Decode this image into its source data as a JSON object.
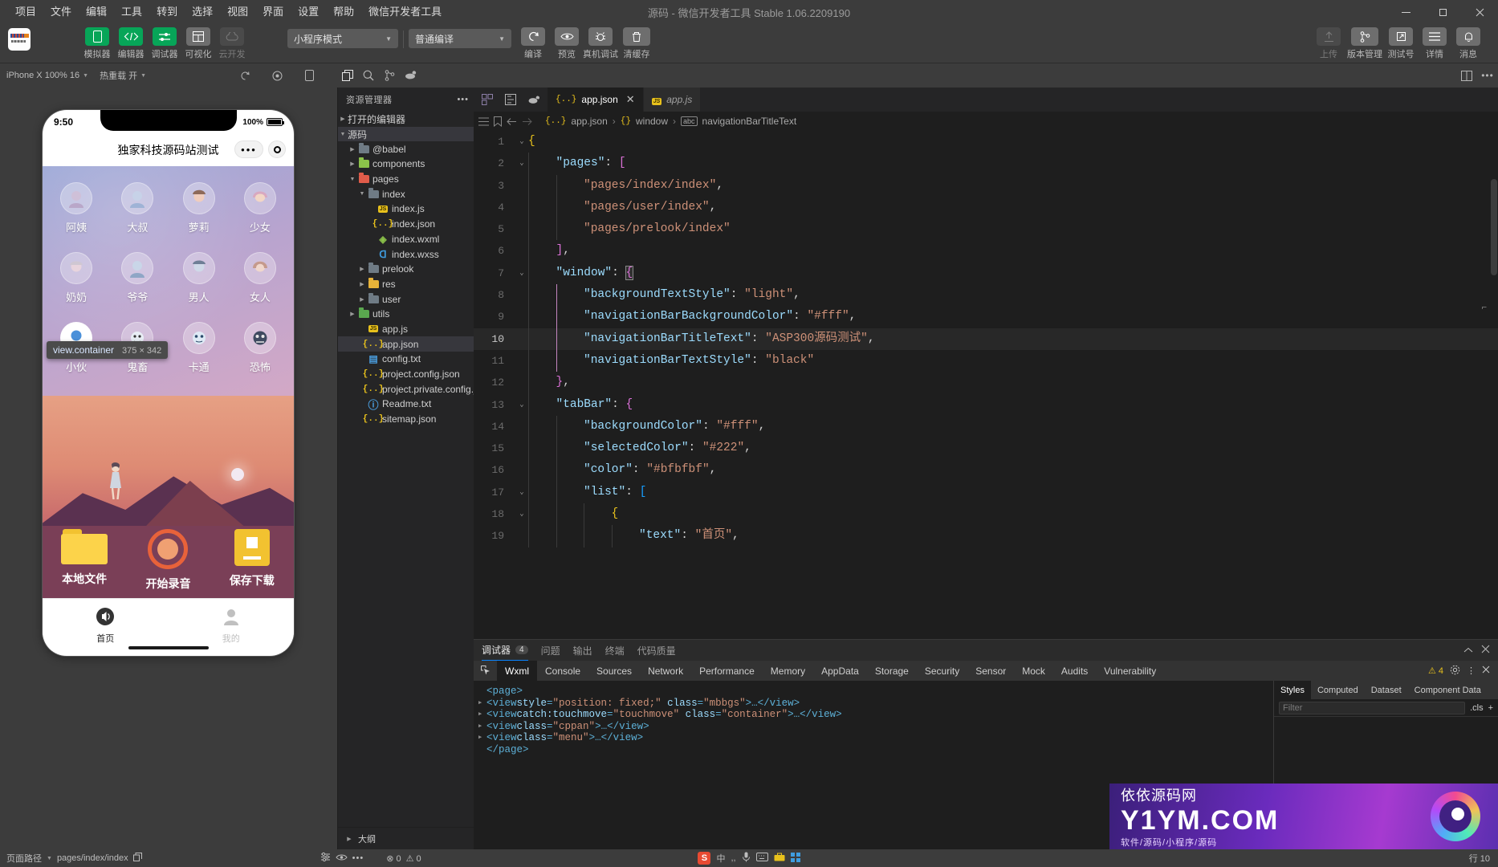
{
  "window": {
    "title": "源码 - 微信开发者工具 Stable 1.06.2209190",
    "controls": {
      "minimize": "minimize-icon",
      "maximize": "maximize-icon",
      "close": "close-icon"
    }
  },
  "menubar": {
    "items": [
      {
        "label": "项目"
      },
      {
        "label": "文件"
      },
      {
        "label": "编辑"
      },
      {
        "label": "工具"
      },
      {
        "label": "转到"
      },
      {
        "label": "选择"
      },
      {
        "label": "视图"
      },
      {
        "label": "界面"
      },
      {
        "label": "设置"
      },
      {
        "label": "帮助"
      },
      {
        "label": "微信开发者工具"
      }
    ]
  },
  "toolbar": {
    "left_buttons": [
      {
        "label": "模拟器",
        "icon": "phone-icon",
        "active": true
      },
      {
        "label": "编辑器",
        "icon": "code-icon",
        "active": true
      },
      {
        "label": "调试器",
        "icon": "sliders-icon",
        "active": true
      },
      {
        "label": "可视化",
        "icon": "layout-icon",
        "active": false
      },
      {
        "label": "云开发",
        "icon": "cloud-icon",
        "active": false
      }
    ],
    "mode_select": {
      "value": "小程序模式",
      "caret": "chevron-down-icon"
    },
    "compile_select": {
      "value": "普通编译",
      "caret": "chevron-down-icon"
    },
    "mid_buttons": [
      {
        "label": "编译",
        "icon": "refresh-icon"
      },
      {
        "label": "预览",
        "icon": "eye-icon"
      },
      {
        "label": "真机调试",
        "icon": "bug-icon"
      },
      {
        "label": "清缓存",
        "icon": "trash-icon"
      }
    ],
    "right_buttons": [
      {
        "label": "上传",
        "icon": "upload-icon",
        "disabled": true
      },
      {
        "label": "版本管理",
        "icon": "branch-icon",
        "disabled": false
      },
      {
        "label": "测试号",
        "icon": "external-link-icon",
        "disabled": false
      },
      {
        "label": "详情",
        "icon": "menu-lines-icon",
        "disabled": false
      },
      {
        "label": "消息",
        "icon": "bell-icon",
        "disabled": false
      }
    ]
  },
  "subbar": {
    "device": "iPhone X 100% 16",
    "hotreload": "热重载 开",
    "icons": [
      "rotate-icon",
      "record-icon",
      "device-icon",
      "copy-files-icon",
      "search-icon",
      "branch-icon",
      "docker-icon",
      "plug-icon"
    ],
    "right_icons": [
      "split-editor-icon",
      "more-icon"
    ]
  },
  "simulator": {
    "status_time": "9:50",
    "battery_text": "100%",
    "page_title": "独家科技源码站测试",
    "capsule": {
      "menu": "•••",
      "target": "target-icon"
    },
    "grid": [
      {
        "label": "阿姨",
        "icon": "avatar-aunt"
      },
      {
        "label": "大叔",
        "icon": "avatar-uncle"
      },
      {
        "label": "萝莉",
        "icon": "avatar-loli"
      },
      {
        "label": "少女",
        "icon": "avatar-girl"
      },
      {
        "label": "奶奶",
        "icon": "avatar-grandma"
      },
      {
        "label": "爷爷",
        "icon": "avatar-grandpa"
      },
      {
        "label": "男人",
        "icon": "avatar-man"
      },
      {
        "label": "女人",
        "icon": "avatar-woman"
      },
      {
        "label": "小伙",
        "icon": "avatar-youth",
        "selected": true
      },
      {
        "label": "鬼畜",
        "icon": "avatar-kichiku"
      },
      {
        "label": "卡通",
        "icon": "avatar-cartoon"
      },
      {
        "label": "恐怖",
        "icon": "avatar-horror"
      }
    ],
    "inspect_tooltip": {
      "selector": "view.container",
      "size": "375 × 342"
    },
    "actions": [
      {
        "label": "本地文件",
        "icon": "folder-icon"
      },
      {
        "label": "开始录音",
        "icon": "record-circle-icon"
      },
      {
        "label": "保存下载",
        "icon": "save-icon"
      }
    ],
    "tabbar": [
      {
        "label": "首页",
        "icon": "speaker-icon",
        "active": true
      },
      {
        "label": "我的",
        "icon": "person-icon",
        "active": false
      }
    ]
  },
  "explorer": {
    "header": "资源管理器",
    "more": "more-icon",
    "sections": [
      {
        "label": "打开的编辑器",
        "expanded": false,
        "indent": 0
      },
      {
        "label": "源码",
        "expanded": true,
        "indent": 0
      }
    ],
    "tree": [
      {
        "label": "@babel",
        "type": "folder",
        "icon": "folder-gray",
        "indent": 1,
        "expanded": false
      },
      {
        "label": "components",
        "type": "folder",
        "icon": "folder-green",
        "indent": 1,
        "expanded": false
      },
      {
        "label": "pages",
        "type": "folder",
        "icon": "folder-red",
        "indent": 1,
        "expanded": true
      },
      {
        "label": "index",
        "type": "folder",
        "icon": "folder-gray",
        "indent": 2,
        "expanded": true
      },
      {
        "label": "index.js",
        "type": "file",
        "icon": "js-icon",
        "indent": 3
      },
      {
        "label": "index.json",
        "type": "file",
        "icon": "json-icon",
        "indent": 3
      },
      {
        "label": "index.wxml",
        "type": "file",
        "icon": "wxml-icon",
        "indent": 3
      },
      {
        "label": "index.wxss",
        "type": "file",
        "icon": "wxss-icon",
        "indent": 3
      },
      {
        "label": "prelook",
        "type": "folder",
        "icon": "folder-gray",
        "indent": 2,
        "expanded": false
      },
      {
        "label": "res",
        "type": "folder",
        "icon": "folder-yellow",
        "indent": 2,
        "expanded": false
      },
      {
        "label": "user",
        "type": "folder",
        "icon": "folder-gray",
        "indent": 2,
        "expanded": false
      },
      {
        "label": "utils",
        "type": "folder",
        "icon": "folder-green",
        "indent": 1,
        "expanded": false
      },
      {
        "label": "app.js",
        "type": "file",
        "icon": "js-icon",
        "indent": 1
      },
      {
        "label": "app.json",
        "type": "file",
        "icon": "json-icon",
        "indent": 1,
        "active": true
      },
      {
        "label": "config.txt",
        "type": "file",
        "icon": "txt-icon",
        "indent": 1
      },
      {
        "label": "project.config.json",
        "type": "file",
        "icon": "json-icon",
        "indent": 1
      },
      {
        "label": "project.private.config.js...",
        "type": "file",
        "icon": "json-icon",
        "indent": 1
      },
      {
        "label": "Readme.txt",
        "type": "file",
        "icon": "info-icon",
        "indent": 1
      },
      {
        "label": "sitemap.json",
        "type": "file",
        "icon": "json-icon",
        "indent": 1
      }
    ],
    "footer": {
      "label": "大纲",
      "expanded": false
    }
  },
  "editor": {
    "strip_icons": [
      "components-icon",
      "snippet-icon",
      "teapot-icon"
    ],
    "tabs": [
      {
        "label": "app.json",
        "icon": "json-icon",
        "active": true,
        "closable": true
      },
      {
        "label": "app.js",
        "icon": "js-icon",
        "active": false,
        "italic": true
      }
    ],
    "gutter_icons": [
      "list-icon",
      "bookmark-icon",
      "arrow-left-icon",
      "arrow-right-icon"
    ],
    "breadcrumb": [
      {
        "label": "app.json",
        "icon": "json-icon"
      },
      {
        "label": "window",
        "icon": "braces-icon"
      },
      {
        "label": "navigationBarTitleText",
        "icon": "abc-icon"
      }
    ],
    "active_line": 10,
    "lines": [
      {
        "n": 1,
        "fold": "chevron-down",
        "indent": 0,
        "tokens": [
          {
            "t": "{",
            "c": "br"
          }
        ]
      },
      {
        "n": 2,
        "fold": "chevron-down",
        "indent": 1,
        "tokens": [
          {
            "t": "\"pages\"",
            "c": "k"
          },
          {
            "t": ": ",
            "c": "p"
          },
          {
            "t": "[",
            "c": "br2"
          }
        ]
      },
      {
        "n": 3,
        "fold": "",
        "indent": 2,
        "tokens": [
          {
            "t": "\"pages/index/index\"",
            "c": "s"
          },
          {
            "t": ",",
            "c": "p"
          }
        ]
      },
      {
        "n": 4,
        "fold": "",
        "indent": 2,
        "tokens": [
          {
            "t": "\"pages/user/index\"",
            "c": "s"
          },
          {
            "t": ",",
            "c": "p"
          }
        ]
      },
      {
        "n": 5,
        "fold": "",
        "indent": 2,
        "tokens": [
          {
            "t": "\"pages/prelook/index\"",
            "c": "s"
          }
        ]
      },
      {
        "n": 6,
        "fold": "",
        "indent": 1,
        "tokens": [
          {
            "t": "]",
            "c": "br2"
          },
          {
            "t": ",",
            "c": "p"
          }
        ]
      },
      {
        "n": 7,
        "fold": "chevron-down",
        "indent": 1,
        "tokens": [
          {
            "t": "\"window\"",
            "c": "k"
          },
          {
            "t": ": ",
            "c": "p"
          },
          {
            "t": "{",
            "c": "br2 bmatch"
          }
        ]
      },
      {
        "n": 8,
        "fold": "",
        "indent": 2,
        "tokens": [
          {
            "t": "\"backgroundTextStyle\"",
            "c": "k"
          },
          {
            "t": ": ",
            "c": "p"
          },
          {
            "t": "\"light\"",
            "c": "s"
          },
          {
            "t": ",",
            "c": "p"
          }
        ]
      },
      {
        "n": 9,
        "fold": "",
        "indent": 2,
        "tokens": [
          {
            "t": "\"navigationBarBackgroundColor\"",
            "c": "k"
          },
          {
            "t": ": ",
            "c": "p"
          },
          {
            "t": "\"#fff\"",
            "c": "s"
          },
          {
            "t": ",",
            "c": "p"
          }
        ]
      },
      {
        "n": 10,
        "fold": "",
        "indent": 2,
        "tokens": [
          {
            "t": "\"navigationBarTitleText\"",
            "c": "k"
          },
          {
            "t": ": ",
            "c": "p"
          },
          {
            "t": "\"ASP300源码测试\"",
            "c": "s"
          },
          {
            "t": ",",
            "c": "p"
          }
        ]
      },
      {
        "n": 11,
        "fold": "",
        "indent": 2,
        "tokens": [
          {
            "t": "\"navigationBarTextStyle\"",
            "c": "k"
          },
          {
            "t": ": ",
            "c": "p"
          },
          {
            "t": "\"black\"",
            "c": "s"
          }
        ]
      },
      {
        "n": 12,
        "fold": "",
        "indent": 1,
        "tokens": [
          {
            "t": "}",
            "c": "br2"
          },
          {
            "t": ",",
            "c": "p"
          }
        ]
      },
      {
        "n": 13,
        "fold": "chevron-down",
        "indent": 1,
        "tokens": [
          {
            "t": "\"tabBar\"",
            "c": "k"
          },
          {
            "t": ": ",
            "c": "p"
          },
          {
            "t": "{",
            "c": "br2"
          }
        ]
      },
      {
        "n": 14,
        "fold": "",
        "indent": 2,
        "tokens": [
          {
            "t": "\"backgroundColor\"",
            "c": "k"
          },
          {
            "t": ": ",
            "c": "p"
          },
          {
            "t": "\"#fff\"",
            "c": "s"
          },
          {
            "t": ",",
            "c": "p"
          }
        ]
      },
      {
        "n": 15,
        "fold": "",
        "indent": 2,
        "tokens": [
          {
            "t": "\"selectedColor\"",
            "c": "k"
          },
          {
            "t": ": ",
            "c": "p"
          },
          {
            "t": "\"#222\"",
            "c": "s"
          },
          {
            "t": ",",
            "c": "p"
          }
        ]
      },
      {
        "n": 16,
        "fold": "",
        "indent": 2,
        "tokens": [
          {
            "t": "\"color\"",
            "c": "k"
          },
          {
            "t": ": ",
            "c": "p"
          },
          {
            "t": "\"#bfbfbf\"",
            "c": "s"
          },
          {
            "t": ",",
            "c": "p"
          }
        ]
      },
      {
        "n": 17,
        "fold": "chevron-down",
        "indent": 2,
        "tokens": [
          {
            "t": "\"list\"",
            "c": "k"
          },
          {
            "t": ": ",
            "c": "p"
          },
          {
            "t": "[",
            "c": "br3"
          }
        ]
      },
      {
        "n": 18,
        "fold": "chevron-down",
        "indent": 3,
        "tokens": [
          {
            "t": "{",
            "c": "br"
          }
        ]
      },
      {
        "n": 19,
        "fold": "",
        "indent": 4,
        "tokens": [
          {
            "t": "\"text\"",
            "c": "k"
          },
          {
            "t": ": ",
            "c": "p"
          },
          {
            "t": "\"首页\"",
            "c": "s"
          },
          {
            "t": ",",
            "c": "p"
          }
        ]
      }
    ]
  },
  "devtools": {
    "top_tabs": [
      {
        "label": "调试器",
        "count": "4",
        "active": true
      },
      {
        "label": "问题",
        "active": false
      },
      {
        "label": "输出",
        "active": false
      },
      {
        "label": "终端",
        "active": false
      },
      {
        "label": "代码质量",
        "active": false
      }
    ],
    "top_right_icons": [
      "chevron-up-icon",
      "close-icon"
    ],
    "panel_tabs": [
      {
        "label": "Wxml",
        "active": true
      },
      {
        "label": "Console",
        "active": false
      },
      {
        "label": "Sources",
        "active": false
      },
      {
        "label": "Network",
        "active": false
      },
      {
        "label": "Performance",
        "active": false
      },
      {
        "label": "Memory",
        "active": false
      },
      {
        "label": "AppData",
        "active": false
      },
      {
        "label": "Storage",
        "active": false
      },
      {
        "label": "Security",
        "active": false
      },
      {
        "label": "Sensor",
        "active": false
      },
      {
        "label": "Mock",
        "active": false
      },
      {
        "label": "Audits",
        "active": false
      },
      {
        "label": "Vulnerability",
        "active": false
      }
    ],
    "panel_right": {
      "warning_count": "4",
      "icons": [
        "gear-icon",
        "more-vertical-icon",
        "close-icon"
      ]
    },
    "dom": [
      {
        "indent": 0,
        "tri": "",
        "parts": [
          {
            "t": "<page>",
            "c": "tg"
          }
        ]
      },
      {
        "indent": 1,
        "tri": "right",
        "parts": [
          {
            "t": "<view ",
            "c": "tg"
          },
          {
            "t": "style",
            "c": "at"
          },
          {
            "t": "=",
            "c": "tg"
          },
          {
            "t": "\"position: fixed;\"",
            "c": "av"
          },
          {
            "t": " ",
            "c": "tg"
          },
          {
            "t": "class",
            "c": "at"
          },
          {
            "t": "=",
            "c": "tg"
          },
          {
            "t": "\"mbbgs\"",
            "c": "av"
          },
          {
            "t": ">…</view>",
            "c": "tg"
          }
        ]
      },
      {
        "indent": 1,
        "tri": "right",
        "parts": [
          {
            "t": "<view ",
            "c": "tg"
          },
          {
            "t": "catch:touchmove",
            "c": "at"
          },
          {
            "t": "=",
            "c": "tg"
          },
          {
            "t": "\"touchmove\"",
            "c": "av"
          },
          {
            "t": " ",
            "c": "tg"
          },
          {
            "t": "class",
            "c": "at"
          },
          {
            "t": "=",
            "c": "tg"
          },
          {
            "t": "\"container\"",
            "c": "av"
          },
          {
            "t": ">…</view>",
            "c": "tg"
          }
        ]
      },
      {
        "indent": 1,
        "tri": "right",
        "parts": [
          {
            "t": "<view ",
            "c": "tg"
          },
          {
            "t": "class",
            "c": "at"
          },
          {
            "t": "=",
            "c": "tg"
          },
          {
            "t": "\"cppan\"",
            "c": "av"
          },
          {
            "t": ">…</view>",
            "c": "tg"
          }
        ]
      },
      {
        "indent": 1,
        "tri": "right",
        "parts": [
          {
            "t": "<view ",
            "c": "tg"
          },
          {
            "t": "class",
            "c": "at"
          },
          {
            "t": "=",
            "c": "tg"
          },
          {
            "t": "\"menu\"",
            "c": "av"
          },
          {
            "t": ">…</view>",
            "c": "tg"
          }
        ]
      },
      {
        "indent": 0,
        "tri": "",
        "parts": [
          {
            "t": "</page>",
            "c": "tg"
          }
        ]
      }
    ],
    "styles": {
      "tabs": [
        {
          "label": "Styles",
          "active": true
        },
        {
          "label": "Computed",
          "active": false
        },
        {
          "label": "Dataset",
          "active": false
        },
        {
          "label": "Component Data",
          "active": false
        }
      ],
      "filter_placeholder": "Filter",
      "cls_label": ".cls",
      "add_label": "+"
    }
  },
  "statusbar": {
    "page_path_label": "页面路径",
    "page_path": "pages/index/index",
    "copy_icon": "copy-icon",
    "errors": "0",
    "warnings": "0",
    "right_icons": [
      "settings-icon",
      "eye-icon",
      "more-icon"
    ],
    "line_col": "行 10",
    "ime": {
      "logo": "S",
      "mode": "中",
      "icons": [
        "comma-icon",
        "mic-icon",
        "keyboard-icon",
        "toolbox-icon",
        "apps-icon"
      ]
    }
  },
  "watermark": {
    "line1": "依依源码网",
    "line2": "Y1YM.COM",
    "line3": "软件/源码/小程序/源码",
    "colors": {
      "bg_start": "#3b1f7a",
      "bg_end": "#5b2fb0"
    }
  },
  "colors": {
    "chrome": "#3c3c3c",
    "editor_bg": "#1e1e1e",
    "explorer_bg": "#252526",
    "accent_green": "#07a558",
    "accent_blue": "#0a84ff",
    "string": "#ce9178",
    "key": "#9cdcfe"
  }
}
